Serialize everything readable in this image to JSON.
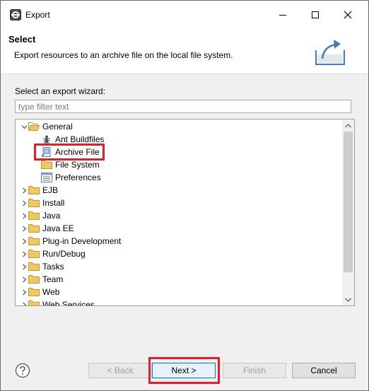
{
  "window": {
    "title": "Export"
  },
  "header": {
    "title": "Select",
    "description": "Export resources to an archive file on the local file system."
  },
  "wizard": {
    "label": "Select an export wizard:",
    "filter_placeholder": "type filter text",
    "tree": [
      {
        "label": "General",
        "level": 0,
        "expanded": true,
        "icon": "folder-open-icon"
      },
      {
        "label": "Ant Buildfiles",
        "level": 1,
        "icon": "ant-icon"
      },
      {
        "label": "Archive File",
        "level": 1,
        "icon": "archive-file-icon",
        "selected": true
      },
      {
        "label": "File System",
        "level": 1,
        "icon": "file-system-icon"
      },
      {
        "label": "Preferences",
        "level": 1,
        "icon": "preferences-icon"
      },
      {
        "label": "EJB",
        "level": 0,
        "icon": "folder-icon"
      },
      {
        "label": "Install",
        "level": 0,
        "icon": "folder-icon"
      },
      {
        "label": "Java",
        "level": 0,
        "icon": "folder-icon"
      },
      {
        "label": "Java EE",
        "level": 0,
        "icon": "folder-icon"
      },
      {
        "label": "Plug-in Development",
        "level": 0,
        "icon": "folder-icon"
      },
      {
        "label": "Run/Debug",
        "level": 0,
        "icon": "folder-icon"
      },
      {
        "label": "Tasks",
        "level": 0,
        "icon": "folder-icon"
      },
      {
        "label": "Team",
        "level": 0,
        "icon": "folder-icon"
      },
      {
        "label": "Web",
        "level": 0,
        "icon": "folder-icon"
      },
      {
        "label": "Web Services",
        "level": 0,
        "icon": "folder-icon"
      }
    ]
  },
  "buttons": {
    "back": "< Back",
    "next": "Next >",
    "finish": "Finish",
    "cancel": "Cancel"
  },
  "colors": {
    "highlight": "#e0202f",
    "primary_border": "#0078d7",
    "folder": "#e8b84a"
  }
}
